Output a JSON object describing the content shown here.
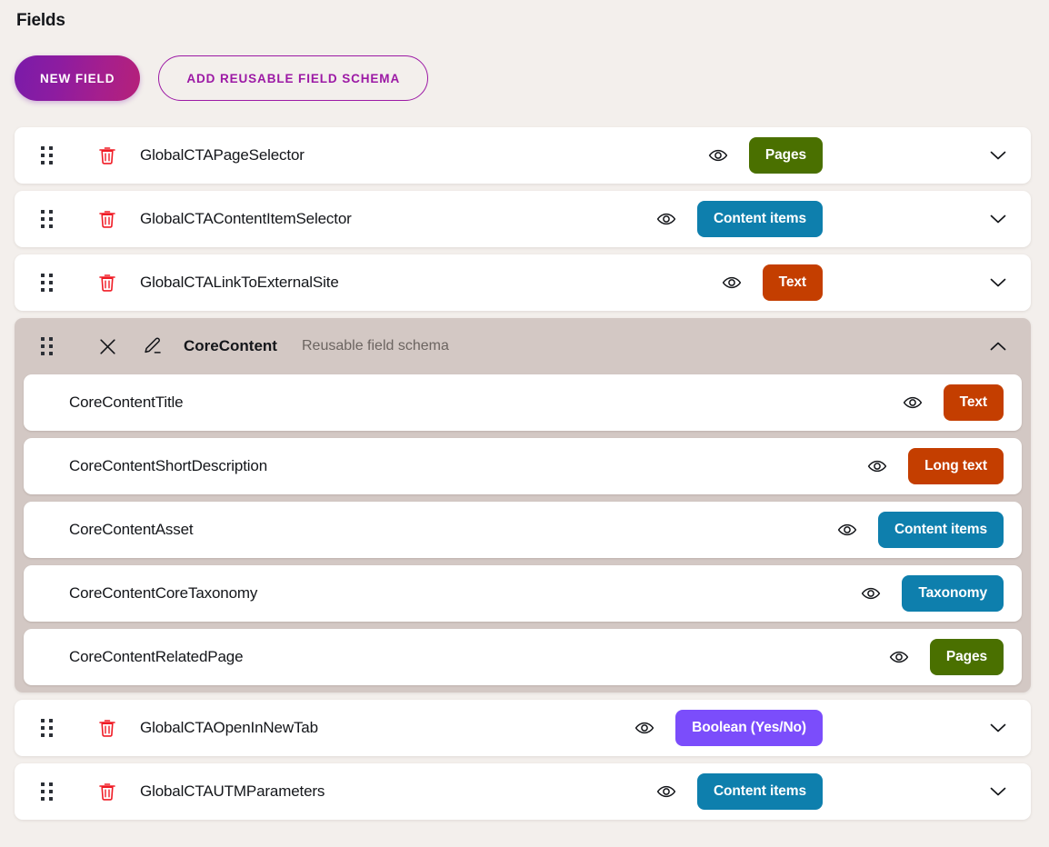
{
  "page": {
    "title": "Fields",
    "background_color": "#f3efec"
  },
  "toolbar": {
    "new_field_label": "NEW FIELD",
    "add_schema_label": "ADD REUSABLE FIELD SCHEMA",
    "new_field_gradient_start": "#7a1ba9",
    "new_field_gradient_end": "#b52079",
    "add_schema_border_color": "#9c19a5"
  },
  "badge_colors": {
    "pages": "#4a7000",
    "content_items": "#0e7fad",
    "text": "#c43e00",
    "long_text": "#c43e00",
    "taxonomy": "#0e7fad",
    "boolean": "#7b4dfb"
  },
  "icons": {
    "drag": "drag-handle-icon",
    "delete": "trash-icon",
    "visibility": "eye-icon",
    "expand": "chevron-down-icon",
    "collapse": "chevron-up-icon",
    "remove": "close-x-icon",
    "edit": "pencil-icon"
  },
  "fields": [
    {
      "name": "GlobalCTAPageSelector",
      "type_label": "Pages",
      "type_color": "#4a7000",
      "has_eye": true,
      "expanded": false
    },
    {
      "name": "GlobalCTAContentItemSelector",
      "type_label": "Content items",
      "type_color": "#0e7fad",
      "has_eye": true,
      "expanded": false
    },
    {
      "name": "GlobalCTALinkToExternalSite",
      "type_label": "Text",
      "type_color": "#c43e00",
      "has_eye": true,
      "expanded": false
    }
  ],
  "schema_group": {
    "title": "CoreContent",
    "subtitle": "Reusable field schema",
    "expanded": true,
    "background_color": "#d3c8c4",
    "fields": [
      {
        "name": "CoreContentTitle",
        "type_label": "Text",
        "type_color": "#c43e00",
        "has_eye": true
      },
      {
        "name": "CoreContentShortDescription",
        "type_label": "Long text",
        "type_color": "#c43e00",
        "has_eye": true
      },
      {
        "name": "CoreContentAsset",
        "type_label": "Content items",
        "type_color": "#0e7fad",
        "has_eye": true
      },
      {
        "name": "CoreContentCoreTaxonomy",
        "type_label": "Taxonomy",
        "type_color": "#0e7fad",
        "has_eye": true
      },
      {
        "name": "CoreContentRelatedPage",
        "type_label": "Pages",
        "type_color": "#4a7000",
        "has_eye": true
      }
    ]
  },
  "fields_after": [
    {
      "name": "GlobalCTAOpenInNewTab",
      "type_label": "Boolean (Yes/No)",
      "type_color": "#7b4dfb",
      "has_eye": true,
      "expanded": false
    },
    {
      "name": "GlobalCTAUTMParameters",
      "type_label": "Content items",
      "type_color": "#0e7fad",
      "has_eye": true,
      "expanded": false
    }
  ]
}
